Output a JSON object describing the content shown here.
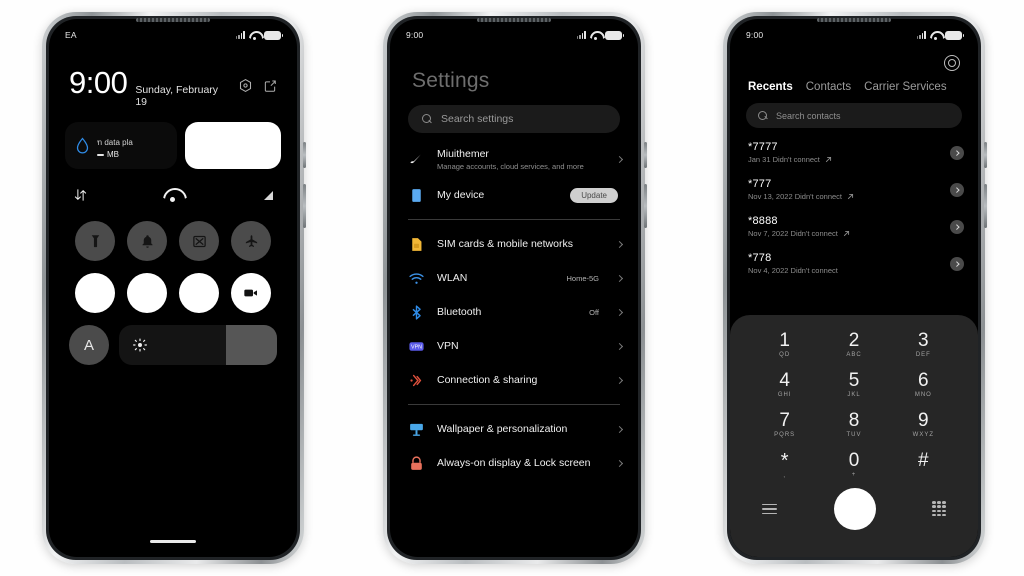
{
  "phone1": {
    "name": "lockscreen-control-center",
    "statusbar": {
      "carrier": "EA",
      "icons": [
        "signal-icon",
        "wifi-icon",
        "battery-icon"
      ]
    },
    "clock": {
      "time": "9:00",
      "date": "Sunday, February 19"
    },
    "actions": [
      {
        "name": "settings-hex-icon"
      },
      {
        "name": "edit-icon"
      }
    ],
    "data_card": {
      "title": "nown data pla",
      "amount": "MB",
      "icon": "water-drop-icon"
    },
    "toprow": [
      {
        "name": "data-sync-icon"
      },
      {
        "name": "wifi-icon"
      },
      {
        "name": "triangle-icon"
      }
    ],
    "tiles": [
      {
        "name": "flashlight-tile",
        "icon": "flashlight-icon",
        "state": "off"
      },
      {
        "name": "ringer-tile",
        "icon": "bell-icon",
        "state": "off"
      },
      {
        "name": "screenshot-tile",
        "icon": "screenshot-icon",
        "state": "off"
      },
      {
        "name": "airplane-mode-tile",
        "icon": "airplane-icon",
        "state": "off"
      },
      {
        "name": "tile-5",
        "icon": "blank-icon",
        "state": "on"
      },
      {
        "name": "tile-6",
        "icon": "blank-icon",
        "state": "on"
      },
      {
        "name": "tile-7",
        "icon": "blank-icon",
        "state": "on"
      },
      {
        "name": "screen-recorder-tile",
        "icon": "video-camera-icon",
        "state": "on"
      }
    ],
    "brightness": {
      "auto_label": "A",
      "icon": "sun-icon",
      "level": 32
    }
  },
  "phone2": {
    "name": "settings-screen",
    "statusbar": {
      "time": "9:00",
      "icons": [
        "signal-icon",
        "wifi-icon",
        "battery-icon"
      ]
    },
    "title": "Settings",
    "search": {
      "placeholder": "Search settings",
      "icon": "search-icon"
    },
    "groups": [
      {
        "rows": [
          {
            "label": "Miuithemer",
            "sub": "Manage accounts, cloud services, and more",
            "icon": "comet-icon",
            "icon_color": "#ffffff",
            "value": "",
            "chip": ""
          },
          {
            "label": "My device",
            "sub": "",
            "icon": "device-icon",
            "icon_color": "#5aa9f0",
            "value": "",
            "chip": "Update"
          }
        ]
      },
      {
        "rows": [
          {
            "label": "SIM cards & mobile networks",
            "sub": "",
            "icon": "sim-card-icon",
            "icon_color": "#f2b736",
            "value": "",
            "chip": ""
          },
          {
            "label": "WLAN",
            "sub": "",
            "icon": "wifi-icon",
            "icon_color": "#3d93e8",
            "value": "Home-5G",
            "chip": ""
          },
          {
            "label": "Bluetooth",
            "sub": "",
            "icon": "bluetooth-icon",
            "icon_color": "#2f8ce8",
            "value": "Off",
            "chip": ""
          },
          {
            "label": "VPN",
            "sub": "",
            "icon": "vpn-icon",
            "icon_color": "#5b5bea",
            "value": "",
            "chip": ""
          },
          {
            "label": "Connection & sharing",
            "sub": "",
            "icon": "connection-sharing-icon",
            "icon_color": "#e0503c",
            "value": "",
            "chip": ""
          }
        ]
      },
      {
        "rows": [
          {
            "label": "Wallpaper & personalization",
            "sub": "",
            "icon": "wallpaper-icon",
            "icon_color": "#49a7e8",
            "value": "",
            "chip": ""
          },
          {
            "label": "Always-on display & Lock screen",
            "sub": "",
            "icon": "lock-icon",
            "icon_color": "#e8715c",
            "value": "",
            "chip": ""
          }
        ]
      }
    ]
  },
  "phone3": {
    "name": "phone-dialer-screen",
    "statusbar": {
      "time": "9:00",
      "icons": [
        "signal-icon",
        "wifi-icon",
        "battery-icon"
      ]
    },
    "settings_icon": "gear-icon",
    "tabs": [
      {
        "label": "Recents",
        "active": true
      },
      {
        "label": "Contacts",
        "active": false
      },
      {
        "label": "Carrier Services",
        "active": false
      }
    ],
    "search": {
      "placeholder": "Search contacts",
      "icon": "search-icon"
    },
    "calls": [
      {
        "number": "*7777",
        "meta": "Jan 31 Didn't connect"
      },
      {
        "number": "*777",
        "meta": "Nov 13, 2022 Didn't connect"
      },
      {
        "number": "*8888",
        "meta": "Nov 7, 2022 Didn't connect"
      },
      {
        "number": "*778",
        "meta": "Nov 4, 2022 Didn't connect"
      }
    ],
    "dialpad": {
      "keys": [
        {
          "digit": "1",
          "sub": "QD"
        },
        {
          "digit": "2",
          "sub": "ABC"
        },
        {
          "digit": "3",
          "sub": "DEF"
        },
        {
          "digit": "4",
          "sub": "GHI"
        },
        {
          "digit": "5",
          "sub": "JKL"
        },
        {
          "digit": "6",
          "sub": "MNO"
        },
        {
          "digit": "7",
          "sub": "PQRS"
        },
        {
          "digit": "8",
          "sub": "TUV"
        },
        {
          "digit": "9",
          "sub": "WXYZ"
        },
        {
          "digit": "*",
          "sub": ","
        },
        {
          "digit": "0",
          "sub": "+"
        },
        {
          "digit": "#",
          "sub": ""
        }
      ],
      "bottom": {
        "menu_icon": "hamburger-icon",
        "call_icon": "call-button",
        "keypad_icon": "keypad-icon"
      }
    }
  }
}
